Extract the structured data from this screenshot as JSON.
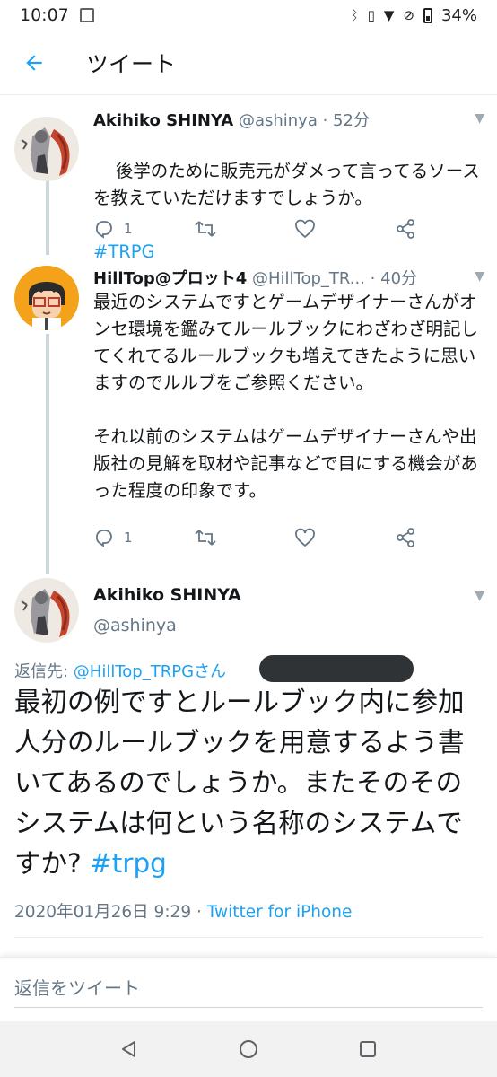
{
  "status_bar": {
    "time": "10:07",
    "battery": "34%"
  },
  "app_bar": {
    "title": "ツイート"
  },
  "tweets": [
    {
      "name": "Akihiko SHINYA",
      "handle": "@ashinya",
      "time": "· 52分",
      "text": "後学のために販売元がダメって言ってるソースを教えていただけますでしょうか。",
      "hashtag": "#TRPG",
      "reply_count": "1"
    },
    {
      "name": "HillTop@プロット4",
      "handle": "@HillTop_TR...",
      "time": "· 40分",
      "text": "最近のシステムですとゲームデザイナーさんがオンセ環境を鑑みてルールブックにわざわざ明記してくれてるルールブックも増えてきたように思いますのでルルブをご参照ください。\n\nそれ以前のシステムはゲームデザイナーさんや出版社の見解を取材や記事などで目にする機会があった程度の印象です。",
      "reply_count": "1"
    }
  ],
  "focused_tweet": {
    "name": "Akihiko SHINYA",
    "handle": "@ashinya",
    "reply_prefix": "返信先: ",
    "reply_to": "@HillTop_TRPGさん",
    "text": "最初の例ですとルールブック内に参加人分のルールブックを用意するよう書いてあるのでしょうか。またそのそのシステムは何という名称のシステムですか? ",
    "hashtag": "#trpg",
    "timestamp": "2020年01月26日 9:29",
    "separator": " · ",
    "source": "Twitter for iPhone"
  },
  "reply_bar": {
    "placeholder": "返信をツイート"
  },
  "colors": {
    "accent": "#1da1f2",
    "secondary_text": "#657786",
    "divider": "#e6ecf0"
  },
  "icons": [
    "back-arrow-icon",
    "reply-icon",
    "retweet-icon",
    "like-icon",
    "share-icon",
    "chevron-down-icon",
    "nav-back-icon",
    "nav-home-icon",
    "nav-recents-icon"
  ]
}
